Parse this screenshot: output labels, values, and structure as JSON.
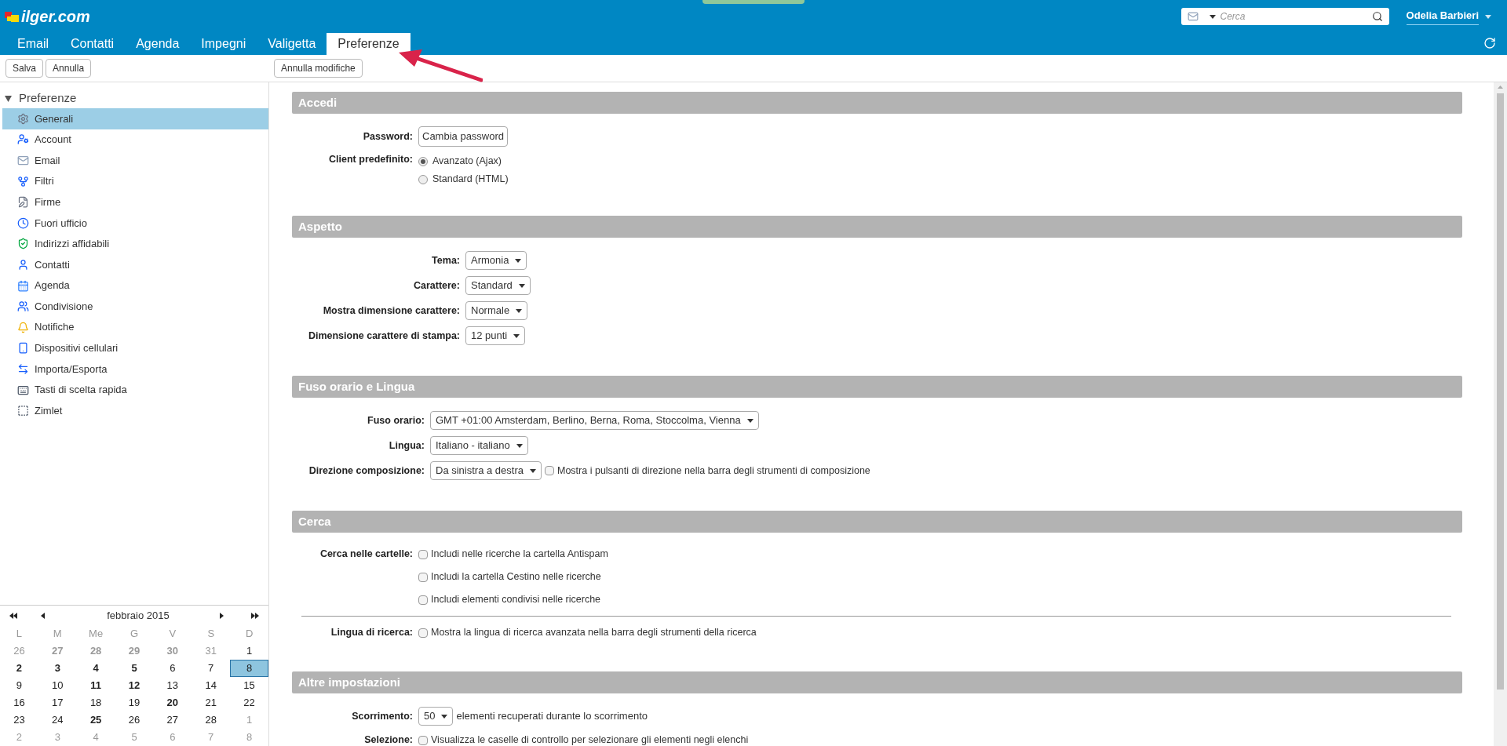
{
  "header": {
    "logo": "ilger.com",
    "search": {
      "placeholder": "Cerca"
    },
    "user": "Odelia Barbieri"
  },
  "tabs": [
    {
      "label": "Email",
      "selected": false
    },
    {
      "label": "Contatti",
      "selected": false
    },
    {
      "label": "Agenda",
      "selected": false
    },
    {
      "label": "Impegni",
      "selected": false
    },
    {
      "label": "Valigetta",
      "selected": false
    },
    {
      "label": "Preferenze",
      "selected": true
    }
  ],
  "toolbar": {
    "left_buttons": [
      "Salva",
      "Annulla"
    ],
    "right_buttons": [
      "Annulla modifiche"
    ]
  },
  "sidebar": {
    "tree": {
      "label": "Preferenze",
      "expanded": true,
      "children": [
        {
          "label": "Generali",
          "selected": true
        },
        {
          "label": "Account",
          "selected": false
        },
        {
          "label": "Email",
          "selected": false
        },
        {
          "label": "Filtri",
          "selected": false
        },
        {
          "label": "Firme",
          "selected": false
        },
        {
          "label": "Fuori ufficio",
          "selected": false
        },
        {
          "label": "Indirizzi affidabili",
          "selected": false
        },
        {
          "label": "Contatti",
          "selected": false
        },
        {
          "label": "Agenda",
          "selected": false
        },
        {
          "label": "Condivisione",
          "selected": false
        },
        {
          "label": "Notifiche",
          "selected": false
        },
        {
          "label": "Dispositivi cellulari",
          "selected": false
        },
        {
          "label": "Importa/Esporta",
          "selected": false
        },
        {
          "label": "Tasti di scelta rapida",
          "selected": false
        },
        {
          "label": "Zimlet",
          "selected": false
        }
      ]
    }
  },
  "calendar": {
    "title": "febbraio 2015",
    "weekdays": [
      "L",
      "M",
      "Me",
      "G",
      "V",
      "S",
      "D"
    ],
    "weeks": [
      [
        {
          "day": "26",
          "bold": false,
          "other_month": true,
          "selected": false
        },
        {
          "day": "27",
          "bold": true,
          "other_month": true,
          "selected": false
        },
        {
          "day": "28",
          "bold": true,
          "other_month": true,
          "selected": false
        },
        {
          "day": "29",
          "bold": true,
          "other_month": true,
          "selected": false
        },
        {
          "day": "30",
          "bold": true,
          "other_month": true,
          "selected": false
        },
        {
          "day": "31",
          "bold": false,
          "other_month": true,
          "selected": false
        },
        {
          "day": "1",
          "bold": false,
          "other_month": false,
          "selected": false
        }
      ],
      [
        {
          "day": "2",
          "bold": true,
          "other_month": false,
          "selected": false
        },
        {
          "day": "3",
          "bold": true,
          "other_month": false,
          "selected": false
        },
        {
          "day": "4",
          "bold": true,
          "other_month": false,
          "selected": false
        },
        {
          "day": "5",
          "bold": true,
          "other_month": false,
          "selected": false
        },
        {
          "day": "6",
          "bold": false,
          "other_month": false,
          "selected": false
        },
        {
          "day": "7",
          "bold": false,
          "other_month": false,
          "selected": false
        },
        {
          "day": "8",
          "bold": false,
          "other_month": false,
          "selected": true
        }
      ],
      [
        {
          "day": "9",
          "bold": false,
          "other_month": false,
          "selected": false
        },
        {
          "day": "10",
          "bold": false,
          "other_month": false,
          "selected": false
        },
        {
          "day": "11",
          "bold": true,
          "other_month": false,
          "selected": false
        },
        {
          "day": "12",
          "bold": true,
          "other_month": false,
          "selected": false
        },
        {
          "day": "13",
          "bold": false,
          "other_month": false,
          "selected": false
        },
        {
          "day": "14",
          "bold": false,
          "other_month": false,
          "selected": false
        },
        {
          "day": "15",
          "bold": false,
          "other_month": false,
          "selected": false
        }
      ],
      [
        {
          "day": "16",
          "bold": false,
          "other_month": false,
          "selected": false
        },
        {
          "day": "17",
          "bold": false,
          "other_month": false,
          "selected": false
        },
        {
          "day": "18",
          "bold": false,
          "other_month": false,
          "selected": false
        },
        {
          "day": "19",
          "bold": false,
          "other_month": false,
          "selected": false
        },
        {
          "day": "20",
          "bold": true,
          "other_month": false,
          "selected": false
        },
        {
          "day": "21",
          "bold": false,
          "other_month": false,
          "selected": false
        },
        {
          "day": "22",
          "bold": false,
          "other_month": false,
          "selected": false
        }
      ],
      [
        {
          "day": "23",
          "bold": false,
          "other_month": false,
          "selected": false
        },
        {
          "day": "24",
          "bold": false,
          "other_month": false,
          "selected": false
        },
        {
          "day": "25",
          "bold": true,
          "other_month": false,
          "selected": false
        },
        {
          "day": "26",
          "bold": false,
          "other_month": false,
          "selected": false
        },
        {
          "day": "27",
          "bold": false,
          "other_month": false,
          "selected": false
        },
        {
          "day": "28",
          "bold": false,
          "other_month": false,
          "selected": false
        },
        {
          "day": "1",
          "bold": false,
          "other_month": true,
          "selected": false
        }
      ],
      [
        {
          "day": "2",
          "bold": false,
          "other_month": true,
          "selected": false
        },
        {
          "day": "3",
          "bold": false,
          "other_month": true,
          "selected": false
        },
        {
          "day": "4",
          "bold": false,
          "other_month": true,
          "selected": false
        },
        {
          "day": "5",
          "bold": false,
          "other_month": true,
          "selected": false
        },
        {
          "day": "6",
          "bold": false,
          "other_month": true,
          "selected": false
        },
        {
          "day": "7",
          "bold": false,
          "other_month": true,
          "selected": false
        },
        {
          "day": "8",
          "bold": false,
          "other_month": true,
          "selected": false
        }
      ]
    ]
  },
  "sections": [
    {
      "title": "Accedi",
      "rows": [
        {
          "kind": "button",
          "label": "Password:",
          "value": "Cambia password"
        },
        {
          "kind": "radio",
          "label": "Client predefinito:",
          "options": [
            {
              "label": "Avanzato (Ajax)",
              "selected": true
            },
            {
              "label": "Standard (HTML)",
              "selected": false
            }
          ]
        }
      ]
    },
    {
      "title": "Aspetto",
      "rows": [
        {
          "kind": "select",
          "label": "Tema:",
          "value": "Armonia"
        },
        {
          "kind": "select",
          "label": "Carattere:",
          "value": "Standard"
        },
        {
          "kind": "select",
          "label": "Mostra dimensione carattere:",
          "value": "Normale"
        },
        {
          "kind": "select",
          "label": "Dimensione carattere di stampa:",
          "value": "12 punti"
        }
      ]
    },
    {
      "title": "Fuso orario e Lingua",
      "rows": [
        {
          "kind": "select",
          "label": "Fuso orario:",
          "value": "GMT +01:00 Amsterdam, Berlino, Berna, Roma, Stoccolma, Vienna"
        },
        {
          "kind": "select",
          "label": "Lingua:",
          "value": "Italiano - italiano"
        },
        {
          "kind": "select",
          "label": "Direzione composizione:",
          "value": "Da sinistra a destra",
          "checkbox": {
            "label": "Mostra i pulsanti di direzione nella barra degli strumenti di composizione",
            "checked": false
          }
        }
      ]
    },
    {
      "title": "Cerca",
      "rows": [
        {
          "kind": "checkboxes",
          "label": "Cerca nelle cartelle:",
          "divider_before": false,
          "options": [
            {
              "label": "Includi nelle ricerche la cartella Antispam",
              "checked": false
            },
            {
              "label": "Includi la cartella Cestino nelle ricerche",
              "checked": false
            },
            {
              "label": "Includi elementi condivisi nelle ricerche",
              "checked": false
            }
          ]
        },
        {
          "kind": "checkboxes",
          "label": "Lingua di ricerca:",
          "divider_before": true,
          "options": [
            {
              "label": "Mostra la lingua di ricerca avanzata nella barra degli strumenti della ricerca",
              "checked": false
            }
          ]
        }
      ]
    },
    {
      "title": "Altre impostazioni",
      "rows": [
        {
          "kind": "select",
          "label": "Scorrimento:",
          "value": "50",
          "note": "elementi recuperati durante lo scorrimento"
        },
        {
          "kind": "checkboxes",
          "label": "Selezione:",
          "divider_before": false,
          "options": [
            {
              "label": "Visualizza le caselle di controllo per selezionare gli elementi negli elenchi",
              "checked": false
            }
          ]
        }
      ]
    }
  ]
}
